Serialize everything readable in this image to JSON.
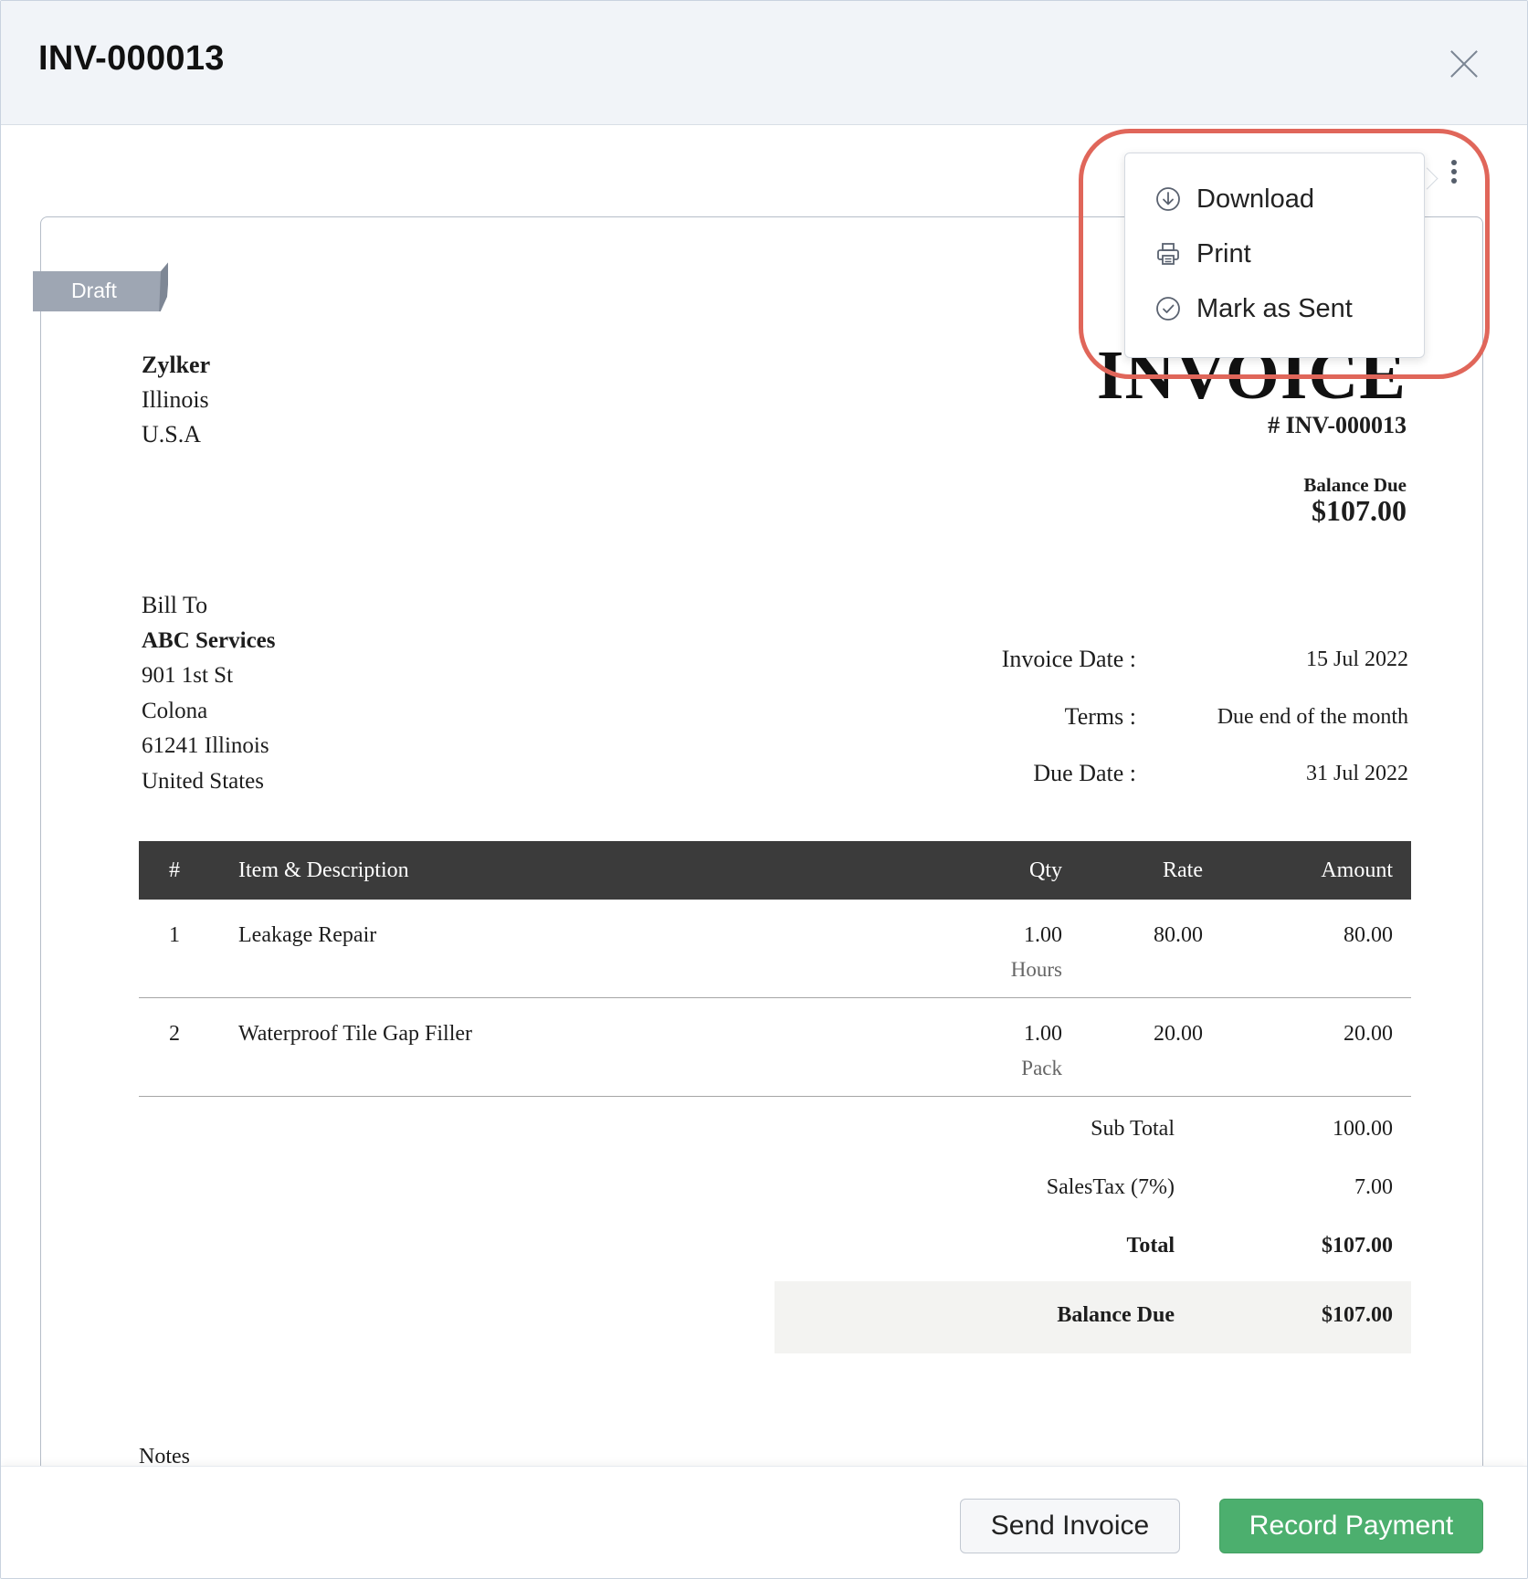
{
  "header": {
    "title": "INV-000013"
  },
  "status_ribbon": {
    "label": "Draft"
  },
  "menu": {
    "items": [
      {
        "label": "Download",
        "icon": "download-circle-icon"
      },
      {
        "label": "Print",
        "icon": "printer-icon"
      },
      {
        "label": "Mark as Sent",
        "icon": "check-circle-icon"
      }
    ]
  },
  "invoice": {
    "title": "INVOICE",
    "number": "# INV-000013",
    "balance_due_label": "Balance Due",
    "balance_due_value": "$107.00",
    "company": {
      "name": "Zylker",
      "line1": "Illinois",
      "line2": "U.S.A"
    },
    "bill_to": {
      "label": "Bill To",
      "name": "ABC Services",
      "line1": "901 1st St",
      "line2": "Colona",
      "line3": "61241 Illinois",
      "line4": "United States"
    },
    "meta": [
      {
        "label": "Invoice Date :",
        "value": "15 Jul 2022"
      },
      {
        "label": "Terms :",
        "value": "Due end of the month"
      },
      {
        "label": "Due Date :",
        "value": "31 Jul 2022"
      }
    ],
    "table": {
      "headers": {
        "num": "#",
        "desc": "Item & Description",
        "qty": "Qty",
        "rate": "Rate",
        "amount": "Amount"
      },
      "rows": [
        {
          "num": "1",
          "desc": "Leakage Repair",
          "qty": "1.00",
          "unit": "Hours",
          "rate": "80.00",
          "amount": "80.00"
        },
        {
          "num": "2",
          "desc": "Waterproof Tile Gap Filler",
          "qty": "1.00",
          "unit": "Pack",
          "rate": "20.00",
          "amount": "20.00"
        }
      ]
    },
    "totals": {
      "subtotal_label": "Sub Total",
      "subtotal_value": "100.00",
      "tax_label": "SalesTax (7%)",
      "tax_value": "7.00",
      "total_label": "Total",
      "total_value": "$107.00",
      "balance_label": "Balance Due",
      "balance_value": "$107.00"
    },
    "notes_label": "Notes"
  },
  "footer": {
    "send_label": "Send Invoice",
    "record_label": "Record Payment"
  },
  "colors": {
    "header_bg": "#f1f4f8",
    "table_header_bg": "#3b3b3b",
    "primary_button": "#4caf6e",
    "highlight_outline": "#e0665a",
    "draft_ribbon": "#9ea6b3"
  }
}
